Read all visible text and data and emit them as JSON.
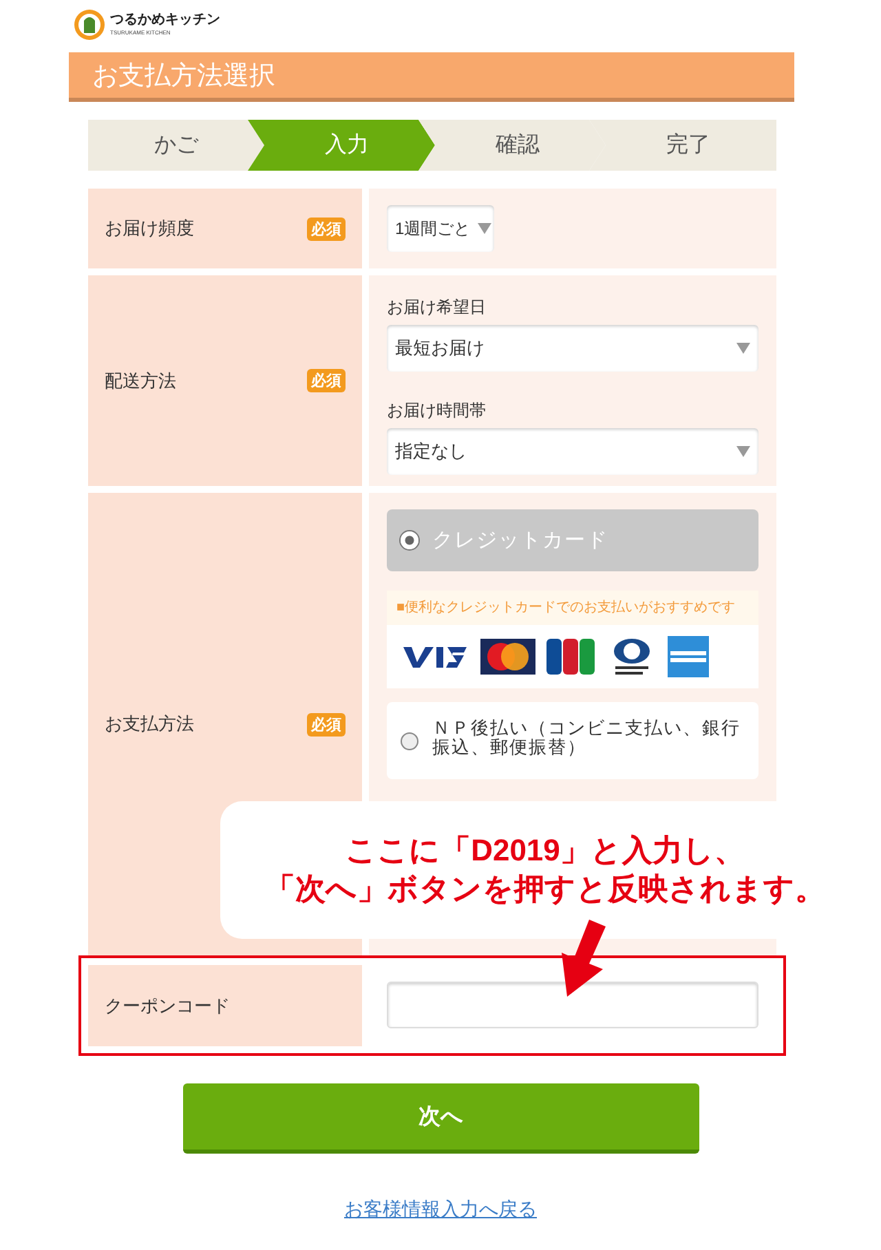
{
  "logo": {
    "name": "つるかめキッチン",
    "subtitle": "TSURUKAME KITCHEN"
  },
  "header": {
    "title": "お支払方法選択"
  },
  "steps": [
    {
      "label": "かご",
      "selected": false
    },
    {
      "label": "入力",
      "selected": true
    },
    {
      "label": "確認",
      "selected": false
    },
    {
      "label": "完了",
      "selected": false
    }
  ],
  "rows": [
    {
      "kind": "select",
      "label": "お届け頻度",
      "badge": "必須",
      "fields": [
        {
          "value": "1週間ごと"
        }
      ]
    },
    {
      "kind": "delivery",
      "label": "配送方法",
      "badge": "必須",
      "fields": [
        {
          "caption": "お届け希望日",
          "value": "最短お届け"
        },
        {
          "caption": "お届け時間帯",
          "value": "指定なし"
        }
      ]
    },
    {
      "kind": "payment",
      "label": "お支払方法",
      "badge": "必須",
      "options": [
        {
          "label": "クレジットカード",
          "selected": true,
          "note": "■便利なクレジットカードでのお支払いがおすすめです"
        },
        {
          "label": "ＮＰ後払い（コンビニ支払い、銀行振込、郵便振替）",
          "selected": false
        }
      ]
    },
    {
      "kind": "text",
      "label": "クーポンコード",
      "highlighted": true
    }
  ],
  "callout": {
    "lines": [
      "ここに「D2019」と入力し、",
      "「次へ」ボタンを押すと反映されます。"
    ]
  },
  "next_button": "次へ",
  "back_link": "お客様情報入力へ戻る"
}
